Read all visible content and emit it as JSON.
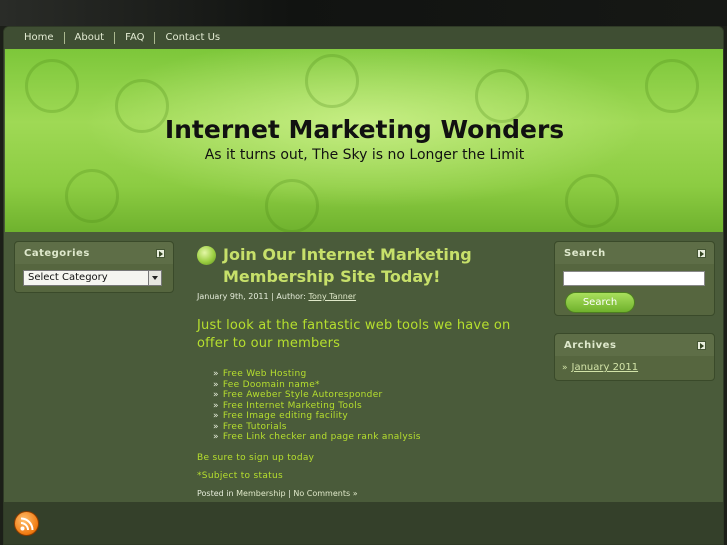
{
  "nav": {
    "items": [
      "Home",
      "About",
      "FAQ",
      "Contact Us"
    ]
  },
  "header": {
    "title": "Internet Marketing Wonders",
    "tagline": "As it turns out, The Sky is no Longer the Limit"
  },
  "sidebar_left": {
    "categories_title": "Categories",
    "category_select_value": "Select Category"
  },
  "sidebar_right": {
    "search_title": "Search",
    "search_button": "Search",
    "archives_title": "Archives",
    "archives": [
      "January 2011"
    ]
  },
  "post": {
    "title": "Join Our Internet Marketing Membership Site Today!",
    "date": "January 9th, 2011",
    "author_label": "Author:",
    "author": "Tony Tanner",
    "lead": "Just  look at the fantastic web tools we have on offer to our members",
    "features": [
      "Free Web Hosting",
      "Fee Doomain name*",
      "Free Aweber Style Autoresponder",
      "Free Internet Marketing Tools",
      "Free Image editing facility",
      "Free Tutorials",
      "Free Link checker and page rank analysis"
    ],
    "p1": "Be sure to sign up today",
    "p2": "*Subject to status",
    "posted_in_label": "Posted in",
    "category": "Membership",
    "comments": "No Comments »"
  },
  "colors": {
    "accent_green": "#b6df2e",
    "page_bg": "#4a5b3a"
  },
  "icons": [
    "arrow-icon",
    "bullet-icon",
    "double-arrow-icon",
    "rss-icon"
  ]
}
